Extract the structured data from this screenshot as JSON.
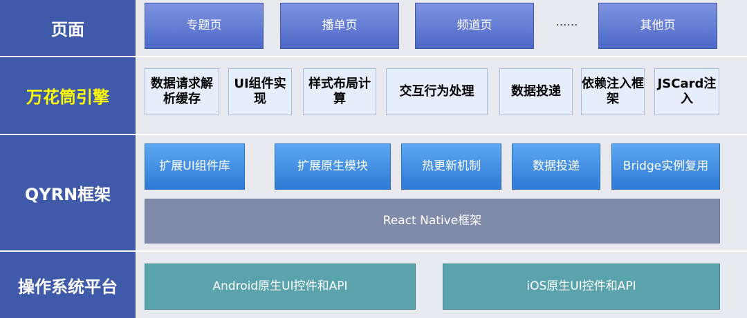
{
  "layers": {
    "page": {
      "label": "页面",
      "items": [
        "专题页",
        "播单页",
        "频道页",
        "其他页"
      ],
      "ellipsis": "……"
    },
    "engine": {
      "label": "万花筒引擎",
      "items": [
        "数据请求解析缓存",
        "UI组件实现",
        "样式布局计算",
        "交互行为处理",
        "数据投递",
        "依赖注入框架",
        "JSCard注入"
      ]
    },
    "qyrn": {
      "label": "QYRN框架",
      "items": [
        "扩展UI组件库",
        "扩展原生模块",
        "热更新机制",
        "数据投递",
        "Bridge实例复用"
      ],
      "base": "React Native框架"
    },
    "os": {
      "label": "操作系统平台",
      "items": [
        "Android原生UI控件和API",
        "iOS原生UI控件和API"
      ]
    }
  },
  "colors": {
    "label_bg": "#3f5aa8",
    "engine_label": "#ffff00",
    "band_bg": "#e8e8ef",
    "page_box": "#5a73d0",
    "qyrn_box": "#3a8ae0",
    "rn_box": "#7f8ba8",
    "os_box": "#5aa3ad"
  }
}
